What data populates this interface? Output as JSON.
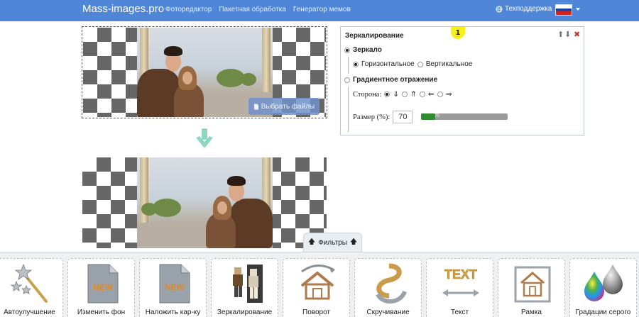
{
  "navbar": {
    "brand": "Mass-images.pro",
    "links": [
      "Фоторедактор",
      "Пакетная обработка",
      "Генератор мемов"
    ],
    "support": "Техподдержка",
    "flag_icon": "russia-flag-icon"
  },
  "upload": {
    "label": "Выбрать файлы"
  },
  "panel": {
    "title": "Зеркалирование",
    "badge": "1",
    "mirror_label": "Зеркало",
    "horizontal_label": "Горизонтальное",
    "vertical_label": "Вертикальное",
    "gradient_label": "Градиентное отражение",
    "side_label": "Сторона:",
    "size_label": "Размер (%):",
    "size_value": "70",
    "slider_value": 70,
    "slider_text": "70",
    "slider_color": "#2e8b2e"
  },
  "filters": {
    "label": "Фильтры"
  },
  "tools": [
    {
      "label": "Автоулучшение",
      "icon": "magic-wand-icon"
    },
    {
      "label": "Изменить фон",
      "icon": "new-file-icon"
    },
    {
      "label": "Наложить кар-ку",
      "icon": "new-file-overlay-icon"
    },
    {
      "label": "Зеркалирование",
      "icon": "mirror-figure-icon"
    },
    {
      "label": "Поворот",
      "icon": "rotate-house-icon"
    },
    {
      "label": "Скручивание",
      "icon": "twist-icon"
    },
    {
      "label": "Текст",
      "icon": "text-icon",
      "art": "TEXT"
    },
    {
      "label": "Рамка",
      "icon": "frame-house-icon"
    },
    {
      "label": "Градации серого",
      "icon": "grayscale-drops-icon"
    }
  ],
  "colors": {
    "navbar": "#4f86d8",
    "accent_arrow": "#8fd6c0",
    "badge": "#f7ef19"
  }
}
